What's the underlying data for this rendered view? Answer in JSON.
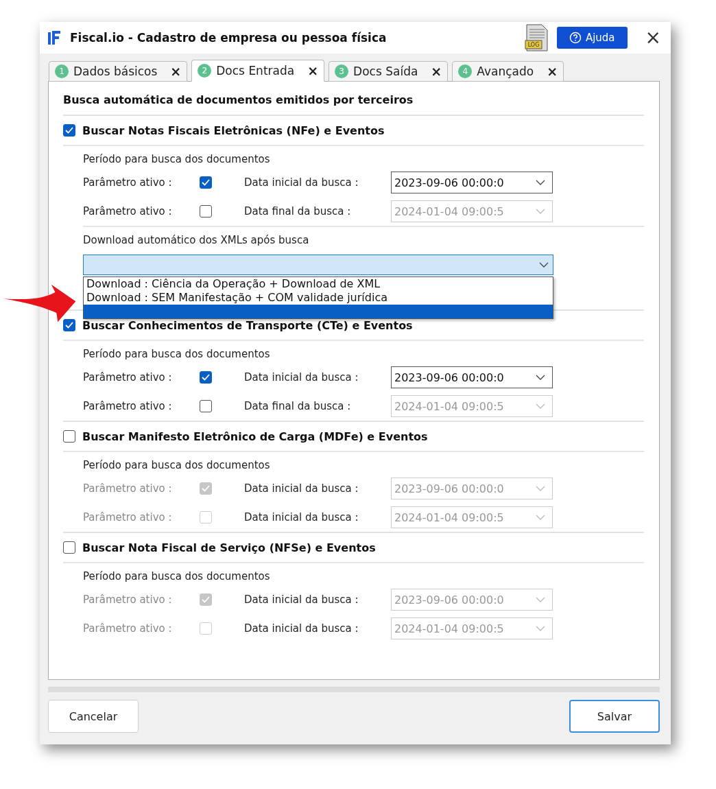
{
  "window": {
    "title": "Fiscal.io - Cadastro de empresa ou pessoa física",
    "log_label": "LOG",
    "help_button": "Ajuda",
    "close": "×"
  },
  "tabs": [
    {
      "number": "1",
      "label": "Dados básicos",
      "close": "×",
      "selected": false
    },
    {
      "number": "2",
      "label": "Docs Entrada",
      "close": "×",
      "selected": true
    },
    {
      "number": "3",
      "label": "Docs Saída",
      "close": "×",
      "selected": false
    },
    {
      "number": "4",
      "label": "Avançado",
      "close": "×",
      "selected": false
    }
  ],
  "heading": "Busca automática de documentos emitidos por terceiros",
  "sections": [
    {
      "title": "Buscar Notas Fiscais Eletrônicas (NFe) e Eventos",
      "checked": true,
      "period_label": "Período para busca dos documentos",
      "rows": [
        {
          "label": "Parâmetro ativo :",
          "checked": true,
          "disabled": false,
          "date_label": "Data inicial da busca :",
          "date": "2023-09-06 00:00:0",
          "date_disabled": false
        },
        {
          "label": "Parâmetro ativo :",
          "checked": false,
          "disabled": false,
          "date_label": "Data final da busca :",
          "date": "2024-01-04 09:00:5",
          "date_disabled": true
        }
      ],
      "download": {
        "label": "Download automático dos XMLs após busca",
        "expanded": true,
        "options": [
          {
            "label": "Download : Ciência da Operação + Download de XML",
            "selected": false
          },
          {
            "label": "Download : SEM Manifestação + COM validade jurídica",
            "selected": false
          }
        ],
        "blank_row_selected": true
      }
    },
    {
      "title": "Buscar Conhecimentos de Transporte (CTe) e Eventos",
      "checked": true,
      "period_label": "Período para busca dos documentos",
      "rows": [
        {
          "label": "Parâmetro ativo :",
          "checked": true,
          "disabled": false,
          "date_label": "Data inicial da busca :",
          "date": "2023-09-06 00:00:0",
          "date_disabled": false
        },
        {
          "label": "Parâmetro ativo :",
          "checked": false,
          "disabled": false,
          "date_label": "Data final da busca :",
          "date": "2024-01-04 09:00:5",
          "date_disabled": true
        }
      ]
    },
    {
      "title": "Buscar Manifesto Eletrônico de Carga (MDFe) e Eventos",
      "checked": false,
      "period_label": "Período para busca dos documentos",
      "rows": [
        {
          "label": "Parâmetro ativo :",
          "checked": true,
          "disabled": true,
          "date_label": "Data inicial da busca :",
          "date": "2023-09-06 00:00:0",
          "date_disabled": true
        },
        {
          "label": "Parâmetro ativo :",
          "checked": false,
          "disabled": true,
          "date_label": "Data inicial da busca :",
          "date": "2024-01-04 09:00:5",
          "date_disabled": true
        }
      ]
    },
    {
      "title": "Buscar Nota Fiscal de Serviço (NFSe) e Eventos",
      "checked": false,
      "period_label": "Período para busca dos documentos",
      "rows": [
        {
          "label": "Parâmetro ativo :",
          "checked": true,
          "disabled": true,
          "date_label": "Data inicial da busca :",
          "date": "2023-09-06 00:00:0",
          "date_disabled": true
        },
        {
          "label": "Parâmetro ativo :",
          "checked": false,
          "disabled": true,
          "date_label": "Data inicial da busca :",
          "date": "2024-01-04 09:00:5",
          "date_disabled": true
        }
      ]
    }
  ],
  "buttons": {
    "cancel": "Cancelar",
    "save": "Salvar"
  }
}
